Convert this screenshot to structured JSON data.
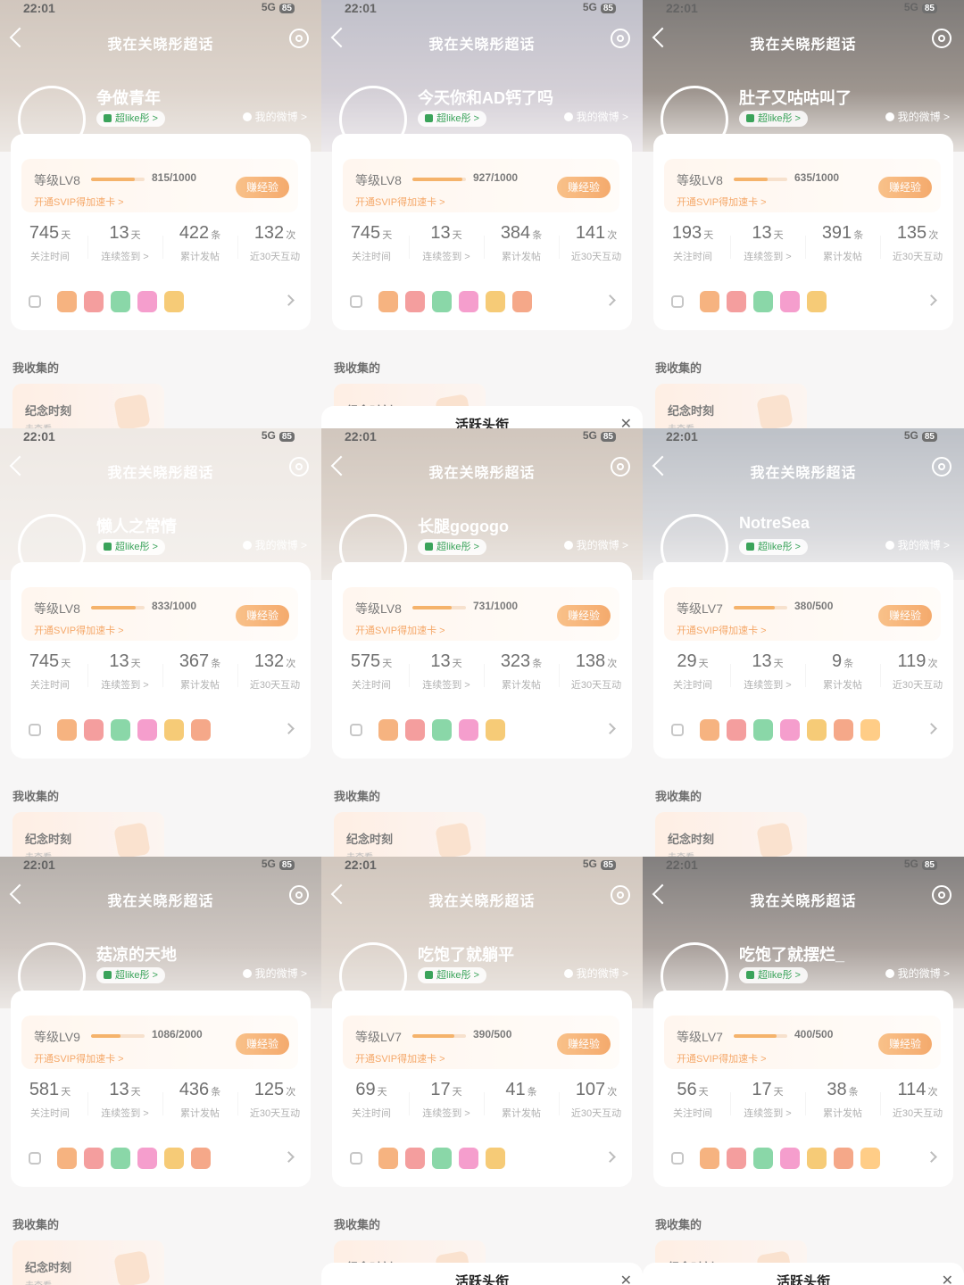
{
  "nav": {
    "title": "我在关晓彤超话"
  },
  "status": {
    "time": "22:01",
    "network": "5G",
    "battery": "85"
  },
  "labels": {
    "badge": "超like彤 >",
    "weibo": "我的微博 >",
    "svip": "开通SVIP得加速卡 >",
    "earn": "赚经验",
    "stat_follow": "关注时间",
    "stat_signin": "连续签到 >",
    "stat_posts": "累计发帖",
    "stat_interact": "近30天互动",
    "unit_day": "天",
    "unit_post": "条",
    "unit_time": "次",
    "collected": "我收集的",
    "memo_title": "纪念时刻",
    "memo_sub": "去查看",
    "popup_title": "活跃头衔"
  },
  "colors": {
    "accent": "#f08a1c",
    "badge_green": "#3aa35a",
    "medal_palette": [
      "#f28a3c",
      "#ef6b6b",
      "#4cc27a",
      "#f06ab2",
      "#f2b02e",
      "#f07a4a",
      "#ffb347"
    ]
  },
  "tiles": [
    {
      "name": "争做青年",
      "level": "等级LV8",
      "exp": "815/1000",
      "exp_pct": 0.815,
      "follow": "745",
      "signin": "13",
      "posts": "422",
      "interact": "132",
      "medals": 5,
      "popup": false
    },
    {
      "name": "今天你和AD钙了吗",
      "level": "等级LV8",
      "exp": "927/1000",
      "exp_pct": 0.927,
      "follow": "745",
      "signin": "13",
      "posts": "384",
      "interact": "141",
      "medals": 6,
      "popup": true
    },
    {
      "name": "肚子又咕咕叫了",
      "level": "等级LV8",
      "exp": "635/1000",
      "exp_pct": 0.635,
      "follow": "193",
      "signin": "13",
      "posts": "391",
      "interact": "135",
      "medals": 5,
      "popup": false
    },
    {
      "name": "懒人之常情",
      "level": "等级LV8",
      "exp": "833/1000",
      "exp_pct": 0.833,
      "follow": "745",
      "signin": "13",
      "posts": "367",
      "interact": "132",
      "medals": 6,
      "popup": false
    },
    {
      "name": "长腿gogogo",
      "level": "等级LV8",
      "exp": "731/1000",
      "exp_pct": 0.731,
      "follow": "575",
      "signin": "13",
      "posts": "323",
      "interact": "138",
      "medals": 5,
      "popup": false
    },
    {
      "name": "NotreSea",
      "level": "等级LV7",
      "exp": "380/500",
      "exp_pct": 0.76,
      "follow": "29",
      "signin": "13",
      "posts": "9",
      "interact": "119",
      "medals": 7,
      "popup": false
    },
    {
      "name": "菇凉的天地",
      "level": "等级LV9",
      "exp": "1086/2000",
      "exp_pct": 0.543,
      "follow": "581",
      "signin": "13",
      "posts": "436",
      "interact": "125",
      "medals": 6,
      "popup": false
    },
    {
      "name": "吃饱了就躺平",
      "level": "等级LV7",
      "exp": "390/500",
      "exp_pct": 0.78,
      "follow": "69",
      "signin": "17",
      "posts": "41",
      "interact": "107",
      "medals": 5,
      "popup": true
    },
    {
      "name": "吃饱了就摆烂_",
      "level": "等级LV7",
      "exp": "400/500",
      "exp_pct": 0.8,
      "follow": "56",
      "signin": "17",
      "posts": "38",
      "interact": "114",
      "medals": 7,
      "popup": true
    }
  ]
}
